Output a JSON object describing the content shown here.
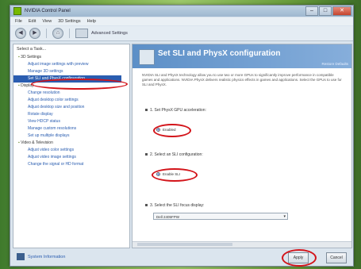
{
  "window": {
    "title": "NVIDIA Control Panel",
    "controls": {
      "minimize": "–",
      "maximize": "□",
      "close": "✕"
    }
  },
  "menubar": {
    "items": [
      "File",
      "Edit",
      "View",
      "3D Settings",
      "Help"
    ]
  },
  "toolbar": {
    "back_icon": "back-arrow-icon",
    "forward_icon": "forward-arrow-icon",
    "home_icon": "home-icon",
    "view_label": "Advanced Settings"
  },
  "sidebar": {
    "header": "Select a Task...",
    "tree": [
      {
        "kind": "cat",
        "label": "3D Settings"
      },
      {
        "kind": "sub",
        "label": "Adjust image settings with preview"
      },
      {
        "kind": "sub",
        "label": "Manage 3D settings"
      },
      {
        "kind": "sub",
        "label": "Set SLI and PhysX configuration",
        "selected": true
      },
      {
        "kind": "cat",
        "label": "Display"
      },
      {
        "kind": "sub",
        "label": "Change resolution"
      },
      {
        "kind": "sub",
        "label": "Adjust desktop color settings"
      },
      {
        "kind": "sub",
        "label": "Adjust desktop size and position"
      },
      {
        "kind": "sub",
        "label": "Rotate display"
      },
      {
        "kind": "sub",
        "label": "View HDCP status"
      },
      {
        "kind": "sub",
        "label": "Manage custom resolutions"
      },
      {
        "kind": "sub",
        "label": "Set up multiple displays"
      },
      {
        "kind": "cat",
        "label": "Video & Television"
      },
      {
        "kind": "sub",
        "label": "Adjust video color settings"
      },
      {
        "kind": "sub",
        "label": "Adjust video image settings"
      },
      {
        "kind": "sub",
        "label": "Change the signal or HD format"
      }
    ]
  },
  "content": {
    "title": "Set SLI and PhysX configuration",
    "restore_link": "Restore Defaults",
    "description": "NVIDIA SLI and PhysX technology allow you to use two or more GPUs to significantly improve performance in compatible games and applications. NVIDIA PhysX delivers realistic physics effects in games and applications. Select the GPUs to use for SLI and PhysX.",
    "physx_section": "1. Set PhysX GPU acceleration:",
    "physx_option": "Enabled",
    "sli_section": "2. Select an SLI configuration:",
    "sli_option": "Enable SLI",
    "display_section": "3. Select the SLI focus display:",
    "display_value": "Dell 2405FPW"
  },
  "bottom": {
    "system_info": "System Information",
    "apply": "Apply",
    "cancel": "Cancel"
  }
}
